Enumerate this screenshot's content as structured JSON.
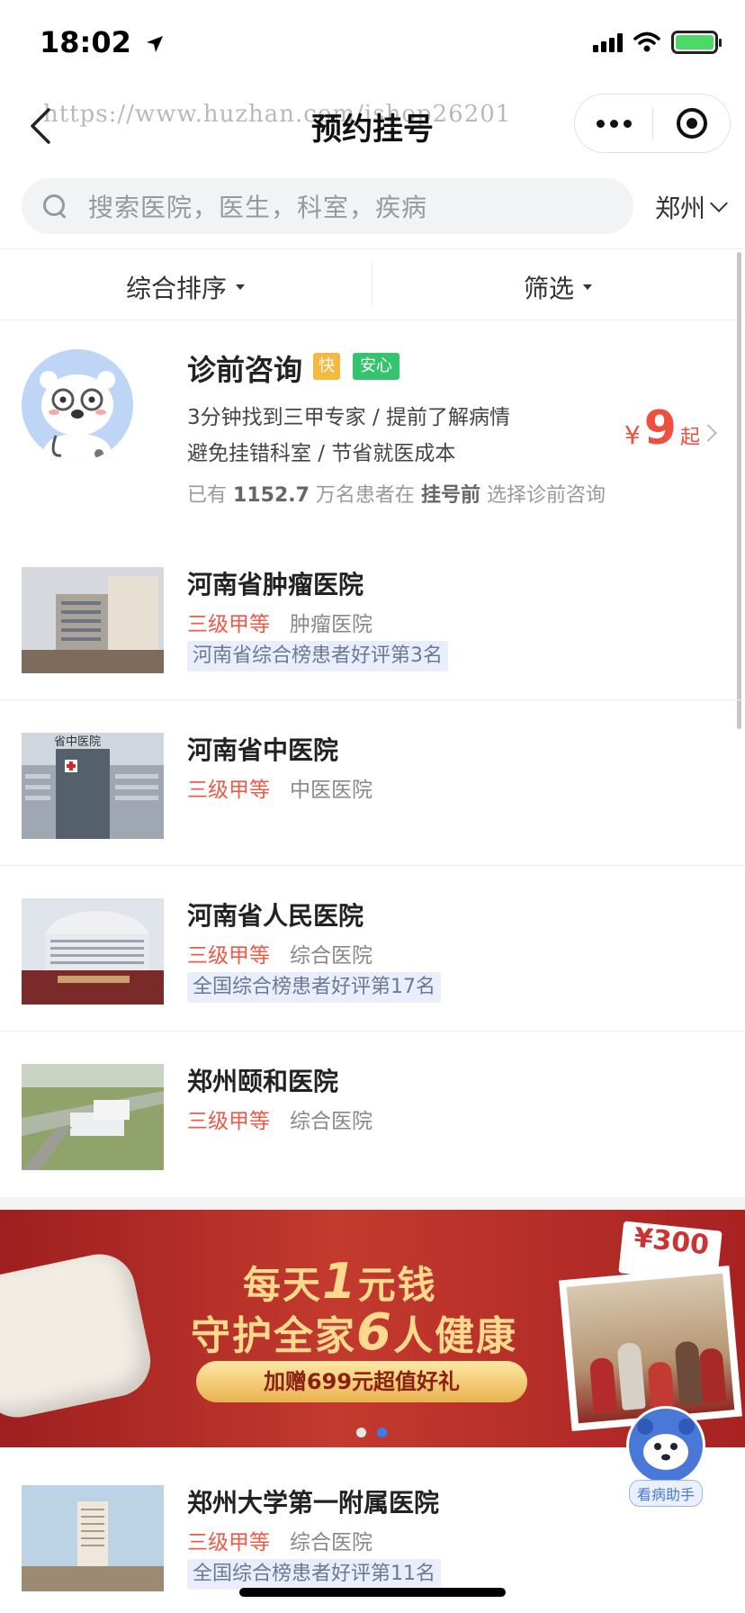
{
  "status_bar": {
    "time": "18:02"
  },
  "nav": {
    "title": "预约挂号",
    "watermark": "https://www.huzhan.com/ishop26201"
  },
  "search": {
    "placeholder": "搜索医院，医生，科室，疾病",
    "city": "郑州"
  },
  "filters": {
    "sort_label": "综合排序",
    "filter_label": "筛选"
  },
  "consult": {
    "title": "诊前咨询",
    "tag_fast": "快",
    "tag_safe": "安心",
    "line1": "3分钟找到三甲专家 / 提前了解病情",
    "line2": "避免挂错科室 / 节省就医成本",
    "stat_prefix": "已有",
    "stat_count": "1152.7",
    "stat_middle": "万名患者在",
    "stat_highlight": "挂号前",
    "stat_suffix": "选择诊前咨询",
    "price_symbol": "¥",
    "price_value": "9",
    "price_unit": "起"
  },
  "hospitals": [
    {
      "name": "河南省肿瘤医院",
      "level": "三级甲等",
      "type": "肿瘤医院",
      "rank": "河南省综合榜患者好评第3名"
    },
    {
      "name": "河南省中医院",
      "level": "三级甲等",
      "type": "中医医院",
      "rank": "",
      "sign_text": "省中医院"
    },
    {
      "name": "河南省人民医院",
      "level": "三级甲等",
      "type": "综合医院",
      "rank": "全国综合榜患者好评第17名"
    },
    {
      "name": "郑州颐和医院",
      "level": "三级甲等",
      "type": "综合医院",
      "rank": ""
    },
    {
      "name": "郑州大学第一附属医院",
      "level": "三级甲等",
      "type": "综合医院",
      "rank": "全国综合榜患者好评第11名"
    }
  ],
  "banner": {
    "line1_a": "每天",
    "line1_num": "1",
    "line1_b": "元钱",
    "line2_a": "守护全家",
    "line2_num": "6",
    "line2_b": "人健康",
    "gift": "加赠699元超值好礼",
    "coupon_amount": "¥300",
    "active_dot": 2,
    "dot_colors": [
      "#e6e6e6",
      "#3a7bf0"
    ]
  },
  "assistant": {
    "label": "看病助手"
  },
  "colors": {
    "accent_red": "#ef5a48",
    "price_red": "#f04e3e",
    "rank_bg": "#e9eefa",
    "tag_fast": "#f5b840",
    "tag_safe": "#35c46e"
  }
}
